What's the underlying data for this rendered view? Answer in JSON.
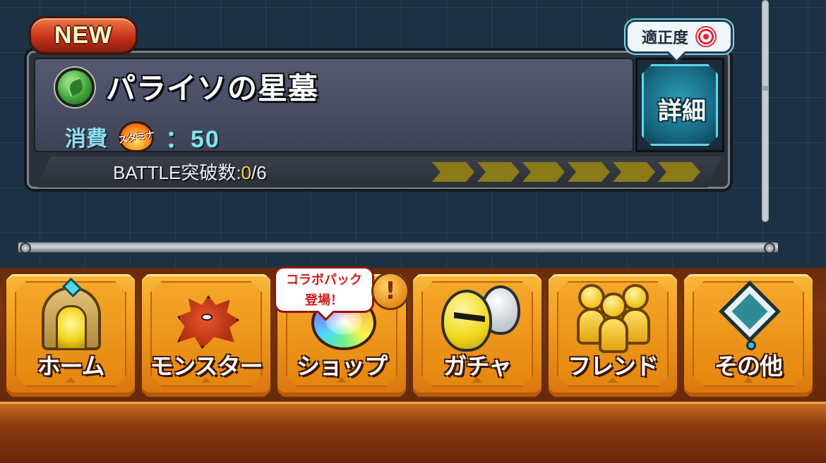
{
  "quest": {
    "new_badge": "NEW",
    "title": "パライソの星墓",
    "element_icon": "wood-element-icon",
    "cost_label": "消費",
    "stamina_icon_text": "スタミナ",
    "cost_value": "：50",
    "detail_label": "詳細",
    "aptitude_label": "適正度",
    "battle_label": "BATTLE突破数:",
    "battle_current": "0",
    "battle_total": "/6",
    "battle_progress": 0,
    "battle_steps": 6
  },
  "nav": {
    "items": [
      {
        "label": "ホーム",
        "icon": "home-gate-icon"
      },
      {
        "label": "モンスター",
        "icon": "monster-icon"
      },
      {
        "label": "ショップ",
        "icon": "rainbow-orb-icon"
      },
      {
        "label": "ガチャ",
        "icon": "egg-icon"
      },
      {
        "label": "フレンド",
        "icon": "friends-icon"
      },
      {
        "label": "その他",
        "icon": "other-icon"
      }
    ],
    "shop_bubble_line1": "コラボパック",
    "shop_bubble_line2": "登場！",
    "alert_mark": "!"
  },
  "colors": {
    "accent_cyan": "#5fd8ea",
    "nav_orange": "#f09a1e",
    "new_red": "#c8321a",
    "battle_current": "#ffd23a"
  }
}
